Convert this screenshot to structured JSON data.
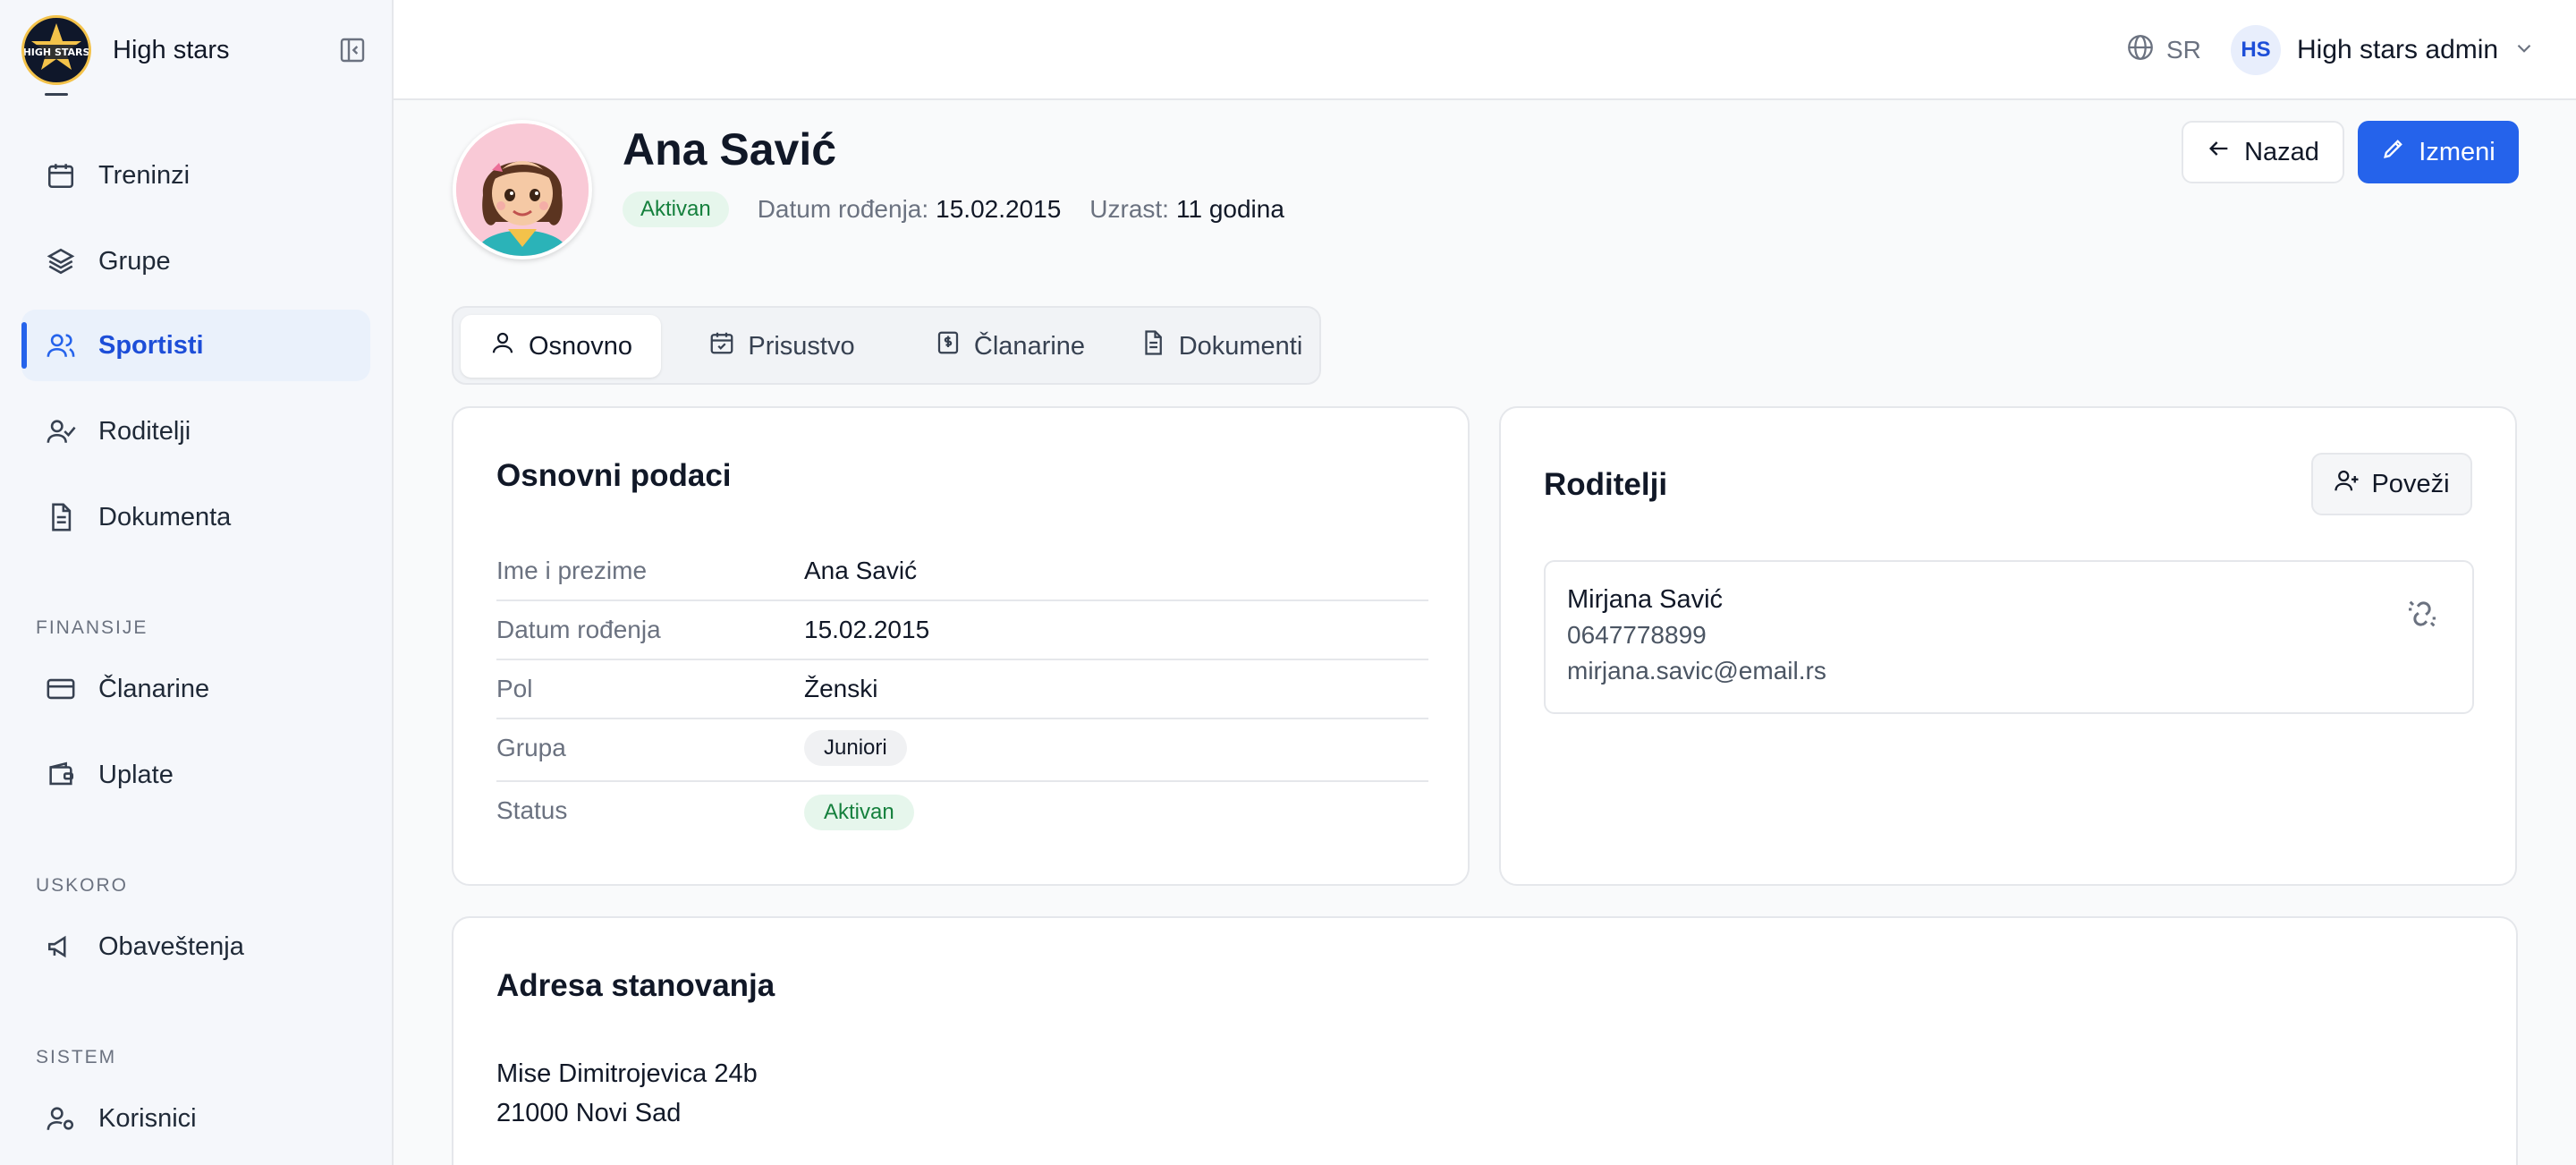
{
  "sidebar": {
    "brand": "High stars",
    "logo_text": "HIGH STARS",
    "items": [
      {
        "label": "Treninzi"
      },
      {
        "label": "Grupe"
      },
      {
        "label": "Sportisti"
      },
      {
        "label": "Roditelji"
      },
      {
        "label": "Dokumenta"
      },
      {
        "label": "Članarine"
      },
      {
        "label": "Uplate"
      },
      {
        "label": "Obaveštenja"
      },
      {
        "label": "Korisnici"
      }
    ],
    "sections": {
      "finance": "FINANSIJE",
      "soon": "USKORO",
      "system": "SISTEM"
    }
  },
  "topbar": {
    "language": "SR",
    "user_initials": "HS",
    "user_name": "High stars admin"
  },
  "profile": {
    "name": "Ana Savić",
    "status": "Aktivan",
    "birth_label": "Datum rođenja:",
    "birth_value": "15.02.2015",
    "age_label": "Uzrast:",
    "age_value": "11 godina"
  },
  "actions": {
    "back": "Nazad",
    "edit": "Izmeni"
  },
  "tabs": [
    {
      "label": "Osnovno"
    },
    {
      "label": "Prisustvo"
    },
    {
      "label": "Članarine"
    },
    {
      "label": "Dokumenti"
    }
  ],
  "basic": {
    "title": "Osnovni podaci",
    "rows": [
      {
        "key": "Ime i prezime",
        "value": "Ana Savić"
      },
      {
        "key": "Datum rođenja",
        "value": "15.02.2015"
      },
      {
        "key": "Pol",
        "value": "Ženski"
      },
      {
        "key": "Grupa",
        "value": "Juniori"
      },
      {
        "key": "Status",
        "value": "Aktivan"
      }
    ]
  },
  "parents": {
    "title": "Roditelji",
    "link_label": "Poveži",
    "items": [
      {
        "name": "Mirjana Savić",
        "phone": "0647778899",
        "email": "mirjana.savic@email.rs"
      }
    ]
  },
  "address": {
    "title": "Adresa stanovanja",
    "line1": "Mise Dimitrojevica 24b",
    "line2": "21000 Novi Sad"
  },
  "colors": {
    "accent": "#2563eb",
    "success_bg": "#e6f6ec",
    "success_text": "#15803d"
  }
}
